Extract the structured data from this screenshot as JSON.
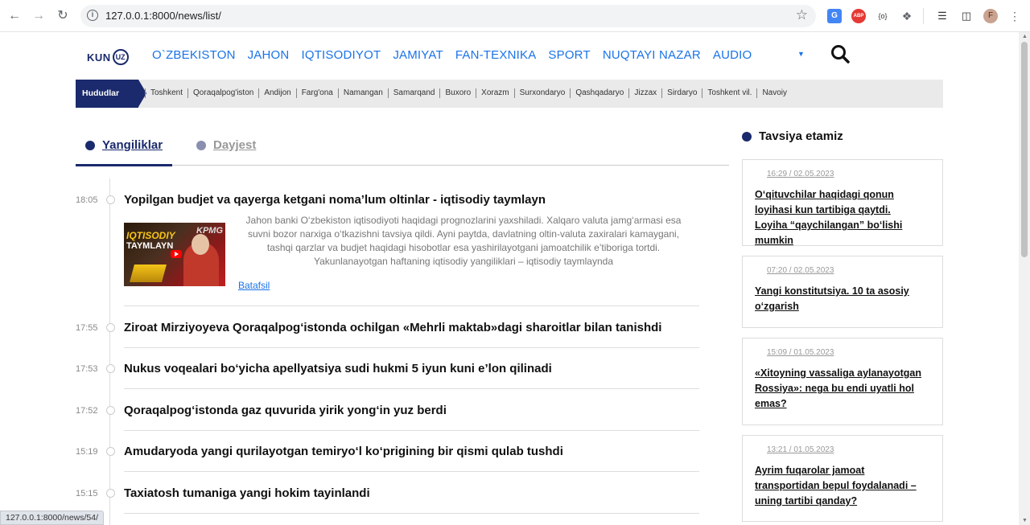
{
  "browser": {
    "url": "127.0.0.1:8000/news/list/",
    "status_url": "127.0.0.1:8000/news/54/",
    "profile_initial": "F",
    "ext_translate": "G",
    "ext_abp": "ABP",
    "ext_code": "{o}"
  },
  "site": {
    "logo_text": "KUN",
    "logo_badge": "UZ",
    "nav": [
      "O`ZBEKISTON",
      "JAHON",
      "IQTISODIYOT",
      "JAMIYAT",
      "FAN-TEXNIKA",
      "SPORT",
      "NUQTAYI NAZAR",
      "AUDIO"
    ]
  },
  "regions": {
    "label": "Hududlar",
    "items": [
      "Toshkent",
      "Qoraqalpog'iston",
      "Andijon",
      "Farg'ona",
      "Namangan",
      "Samarqand",
      "Buxoro",
      "Xorazm",
      "Surxondaryo",
      "Qashqadaryo",
      "Jizzax",
      "Sirdaryo",
      "Toshkent vil.",
      "Navoiy"
    ]
  },
  "tabs": {
    "active": "Yangiliklar",
    "inactive": "Dayjest"
  },
  "news": [
    {
      "time": "18:05",
      "title": "Yopilgan budjet va qayerga ketgani noma’lum oltinlar - iqtisodiy taymlayn"
    },
    {
      "time": "17:55",
      "title": "Ziroat Mirziyoyeva Qoraqalpog‘istonda ochilgan «Mehrli maktab»dagi sharoitlar bilan tanishdi"
    },
    {
      "time": "17:53",
      "title": "Nukus voqealari bo‘yicha apellyatsiya sudi hukmi 5 iyun kuni e’lon qilinadi"
    },
    {
      "time": "17:52",
      "title": "Qoraqalpog‘istonda gaz quvurida yirik yong‘in yuz berdi"
    },
    {
      "time": "15:19",
      "title": "Amudaryoda yangi qurilayotgan temiryo‘l ko‘prigining bir qismi qulab tushdi"
    },
    {
      "time": "15:15",
      "title": "Taxiatosh tumaniga yangi hokim tayinlandi"
    }
  ],
  "featured": {
    "summary": "Jahon banki O‘zbekiston iqtisodiyoti haqidagi prognozlarini yaxshiladi. Xalqaro valuta jamg‘armasi esa suvni bozor narxiga o‘tkazishni tavsiya qildi. Ayni paytda, davlatning oltin-valuta zaxiralari kamaygani, tashqi qarzlar va budjet haqidagi hisobotlar esa yashirilayotgani jamoatchilik e’tiboriga tortdi. Yakunlanayotgan haftaning iqtisodiy yangiliklari – iqtisodiy taymlaynda",
    "more": "Batafsil",
    "thumb_line1": "IQTISODIY",
    "thumb_line2": "TAYMLAYN",
    "thumb_brand": "KPMG"
  },
  "sidebar": {
    "title": "Tavsiya etamiz",
    "cards": [
      {
        "date": "16:29 / 02.05.2023",
        "title": "O‘qituvchilar haqidagi qonun loyihasi kun tartibiga qaytdi. Loyiha “qaychilangan” bo‘lishi mumkin"
      },
      {
        "date": "07:20 / 02.05.2023",
        "title": "Yangi konstitutsiya. 10 ta asosiy o‘zgarish"
      },
      {
        "date": "15:09 / 01.05.2023",
        "title": "«Xitoyning vassaliga aylanayotgan Rossiya»: nega bu endi uyatli hol emas?"
      },
      {
        "date": "13:21 / 01.05.2023",
        "title": "Ayrim fuqarolar jamoat transportidan bepul foydalanadi – uning tartibi qanday?"
      }
    ]
  }
}
